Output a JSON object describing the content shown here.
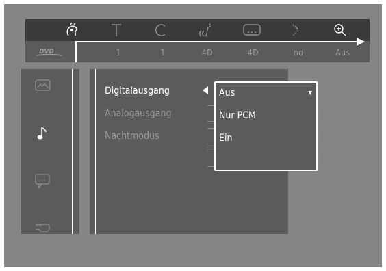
{
  "topbar": {
    "logo": "DVD",
    "icons": [
      "character-icon",
      "text-icon",
      "clock-icon",
      "sound-wave-icon",
      "subtitle-icon",
      "arrow-icon",
      "zoom-icon"
    ],
    "values": [
      "1",
      "1",
      "4D",
      "4D",
      "no",
      "Aus"
    ]
  },
  "leftnav": {
    "icons": [
      "picture-icon",
      "music-note-icon",
      "speech-bubble-icon",
      "hand-icon"
    ]
  },
  "menu": {
    "items": [
      {
        "label": "Digitalausgang",
        "active": true
      },
      {
        "label": "Analogausgang",
        "active": false
      },
      {
        "label": "Nachtmodus",
        "active": false
      }
    ]
  },
  "dropdown": {
    "selected": "Aus",
    "options": [
      "Aus",
      "Nur PCM",
      "Ein"
    ]
  },
  "colors": {
    "background": "#858585",
    "panel": "#5b5b5b",
    "iconbar": "#3a3a3a",
    "active_text": "#ffffff",
    "dim_text": "#9a9a9a"
  }
}
